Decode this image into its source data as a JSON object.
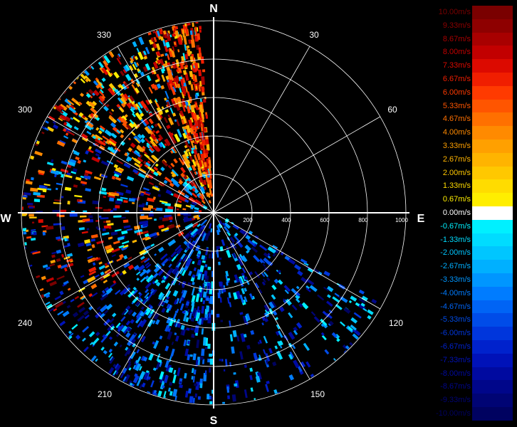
{
  "chart_data": {
    "type": "polar-radial-velocity",
    "compass": {
      "n": "N",
      "e": "E",
      "s": "S",
      "w": "W"
    },
    "bearing_labels": [
      "30",
      "60",
      "120",
      "150",
      "210",
      "240",
      "300",
      "330"
    ],
    "bearing_values": [
      30,
      60,
      120,
      150,
      210,
      240,
      300,
      330
    ],
    "range_ticks": [
      "200",
      "400",
      "600",
      "800",
      "1000"
    ],
    "range_values": [
      200,
      400,
      600,
      800,
      1000
    ],
    "range_max": 1000,
    "spokes_deg": [
      30,
      60,
      120,
      150,
      210,
      240,
      300,
      330
    ],
    "legend": {
      "units": "m/s",
      "entries": [
        {
          "label": "10.00m/s",
          "color": "#7a0000"
        },
        {
          "label": "9.33m/s",
          "color": "#8e0000"
        },
        {
          "label": "8.67m/s",
          "color": "#a80000"
        },
        {
          "label": "8.00m/s",
          "color": "#c20000"
        },
        {
          "label": "7.33m/s",
          "color": "#dc0a00"
        },
        {
          "label": "6.67m/s",
          "color": "#f01e00"
        },
        {
          "label": "6.00m/s",
          "color": "#ff3a00"
        },
        {
          "label": "5.33m/s",
          "color": "#ff5500"
        },
        {
          "label": "4.67m/s",
          "color": "#ff7000"
        },
        {
          "label": "4.00m/s",
          "color": "#ff8a00"
        },
        {
          "label": "3.33m/s",
          "color": "#ffa000"
        },
        {
          "label": "2.67m/s",
          "color": "#ffb400"
        },
        {
          "label": "2.00m/s",
          "color": "#ffc800"
        },
        {
          "label": "1.33m/s",
          "color": "#ffdc00"
        },
        {
          "label": "0.67m/s",
          "color": "#ffee00"
        },
        {
          "label": "0.00m/s",
          "color": "#ffffff"
        },
        {
          "label": "-0.67m/s",
          "color": "#00f0ff"
        },
        {
          "label": "-1.33m/s",
          "color": "#00dcff"
        },
        {
          "label": "-2.00m/s",
          "color": "#00c6ff"
        },
        {
          "label": "-2.67m/s",
          "color": "#00b0ff"
        },
        {
          "label": "-3.33m/s",
          "color": "#0096ff"
        },
        {
          "label": "-4.00m/s",
          "color": "#007cff"
        },
        {
          "label": "-4.67m/s",
          "color": "#0064f5"
        },
        {
          "label": "-5.33m/s",
          "color": "#004ce8"
        },
        {
          "label": "-6.00m/s",
          "color": "#0036dc"
        },
        {
          "label": "-6.67m/s",
          "color": "#0022cc"
        },
        {
          "label": "-7.33m/s",
          "color": "#0012b8"
        },
        {
          "label": "-8.00m/s",
          "color": "#000aa0"
        },
        {
          "label": "-8.67m/s",
          "color": "#00068a"
        },
        {
          "label": "-9.33m/s",
          "color": "#000474"
        },
        {
          "label": "-10.00m/s",
          "color": "#000260"
        }
      ]
    }
  }
}
